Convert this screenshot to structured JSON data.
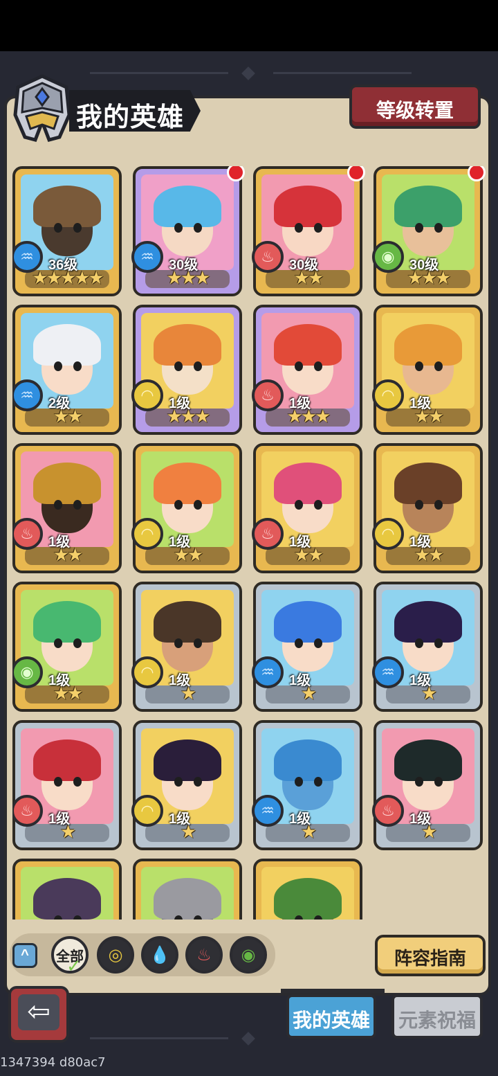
{
  "header": {
    "title": "我的英雄",
    "reset_button": "等级转置"
  },
  "heroes": [
    {
      "level": "36级",
      "stars": "★★★★★",
      "rarity": "gold",
      "element": "water",
      "new": false,
      "hair": "#7a5a3a",
      "face": "#4a3a2e",
      "bg": "#8fd3ef"
    },
    {
      "level": "30级",
      "stars": "★★★",
      "rarity": "purple",
      "element": "water",
      "new": true,
      "hair": "#58b8e8",
      "face": "#f5d9c4",
      "bg": "#f0a0c8"
    },
    {
      "level": "30级",
      "stars": "★★",
      "rarity": "gold",
      "element": "fire",
      "new": true,
      "hair": "#d6333a",
      "face": "#f8d8c4",
      "bg": "#f29ab0"
    },
    {
      "level": "30级",
      "stars": "★★★",
      "rarity": "gold",
      "element": "wind",
      "new": true,
      "hair": "#3ca06a",
      "face": "#e8c09a",
      "bg": "#b9e06a"
    },
    {
      "level": "2级",
      "stars": "★★",
      "rarity": "gold",
      "element": "water",
      "new": false,
      "hair": "#eef0f4",
      "face": "#f8dcc8",
      "bg": "#8fd3ef"
    },
    {
      "level": "1级",
      "stars": "★★★",
      "rarity": "purple",
      "element": "earth",
      "new": false,
      "hair": "#e8863a",
      "face": "#f4e0c8",
      "bg": "#f2d060"
    },
    {
      "level": "1级",
      "stars": "★★★",
      "rarity": "purple",
      "element": "fire",
      "new": false,
      "hair": "#e24a38",
      "face": "#f8dcc8",
      "bg": "#f29ab0"
    },
    {
      "level": "1级",
      "stars": "★★",
      "rarity": "gold",
      "element": "earth",
      "new": false,
      "hair": "#e89a38",
      "face": "#e8b890",
      "bg": "#f2d060"
    },
    {
      "level": "1级",
      "stars": "★★",
      "rarity": "gold",
      "element": "fire",
      "new": false,
      "hair": "#c8922e",
      "face": "#3a2a20",
      "bg": "#f29ab0"
    },
    {
      "level": "1级",
      "stars": "★★",
      "rarity": "gold",
      "element": "earth",
      "new": false,
      "hair": "#f08040",
      "face": "#f8dcc8",
      "bg": "#b9e06a"
    },
    {
      "level": "1级",
      "stars": "★★",
      "rarity": "gold",
      "element": "fire",
      "new": false,
      "hair": "#e0507a",
      "face": "#f8dcc8",
      "bg": "#f2d060"
    },
    {
      "level": "1级",
      "stars": "★★",
      "rarity": "gold",
      "element": "earth",
      "new": false,
      "hair": "#6a4028",
      "face": "#b8845a",
      "bg": "#f2d060"
    },
    {
      "level": "1级",
      "stars": "★★",
      "rarity": "gold",
      "element": "wind",
      "new": false,
      "hair": "#48b870",
      "face": "#f8dcc8",
      "bg": "#b9e06a"
    },
    {
      "level": "1级",
      "stars": "★",
      "rarity": "silver",
      "element": "earth",
      "new": false,
      "hair": "#4a3628",
      "face": "#d8a07a",
      "bg": "#f2d060"
    },
    {
      "level": "1级",
      "stars": "★",
      "rarity": "silver",
      "element": "water",
      "new": false,
      "hair": "#3a7ae0",
      "face": "#f8dcc8",
      "bg": "#8fd3ef"
    },
    {
      "level": "1级",
      "stars": "★",
      "rarity": "silver",
      "element": "water",
      "new": false,
      "hair": "#2a1e4a",
      "face": "#f8dcc8",
      "bg": "#8fd3ef"
    },
    {
      "level": "1级",
      "stars": "★",
      "rarity": "silver",
      "element": "fire",
      "new": false,
      "hair": "#c8303a",
      "face": "#f8dcc8",
      "bg": "#f29ab0"
    },
    {
      "level": "1级",
      "stars": "★",
      "rarity": "silver",
      "element": "earth",
      "new": false,
      "hair": "#2a1e3a",
      "face": "#f8dcc8",
      "bg": "#f2d060"
    },
    {
      "level": "1级",
      "stars": "★",
      "rarity": "silver",
      "element": "water",
      "new": false,
      "hair": "#3a8ad0",
      "face": "#5aa0d8",
      "bg": "#8fd3ef"
    },
    {
      "level": "1级",
      "stars": "★",
      "rarity": "silver",
      "element": "fire",
      "new": false,
      "hair": "#1e2a2a",
      "face": "#f8dcc8",
      "bg": "#f29ab0"
    },
    {
      "level": "",
      "stars": "",
      "rarity": "gold",
      "element": "",
      "new": false,
      "hair": "#4a3a5a",
      "face": "#d8d070",
      "bg": "#b9e06a"
    },
    {
      "level": "",
      "stars": "",
      "rarity": "gold",
      "element": "",
      "new": false,
      "hair": "#9a9aa0",
      "face": "#6a6a72",
      "bg": "#b9e06a"
    },
    {
      "level": "",
      "stars": "",
      "rarity": "gold",
      "element": "",
      "new": false,
      "hair": "#4a8a3a",
      "face": "#8a6a3a",
      "bg": "#f2d060"
    }
  ],
  "filters": {
    "all_label": "全部",
    "items": [
      "earth",
      "water",
      "fire",
      "wind"
    ]
  },
  "guide_button": "阵容指南",
  "tabs": {
    "my_heroes": "我的英雄",
    "element_blessing": "元素祝福"
  },
  "debug_text": "1347394 d80ac7",
  "colors": {
    "water": "#2f8fe0",
    "fire": "#e25a5a",
    "earth": "#e8c840",
    "wind": "#67b845"
  }
}
